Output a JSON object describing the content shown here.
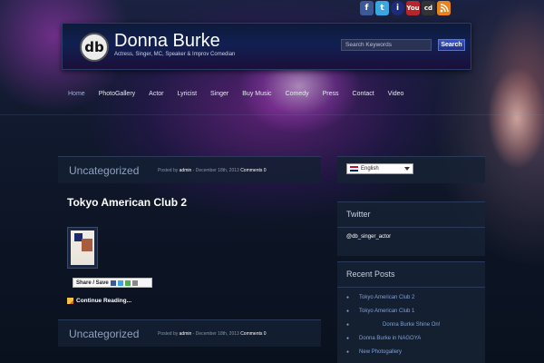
{
  "social": [
    "f",
    "t",
    "i",
    "You",
    "cd",
    "rss"
  ],
  "header": {
    "logo": "db",
    "title": "Donna Burke",
    "tagline": "Actress, Singer, MC, Speaker & Improv Comedian",
    "search_placeholder": "Search Keywords",
    "search_button": "Search"
  },
  "nav": [
    "Home",
    "PhotoGallery",
    "Actor",
    "Lyricist",
    "Singer",
    "Buy Music",
    "Comedy",
    "Press",
    "Contact",
    "Video"
  ],
  "posts": [
    {
      "category": "Uncategorized",
      "byline_prefix": "Posted by ",
      "author": "admin",
      "date": " - December 18th, 2013 ",
      "comments": "Comments 0",
      "title": "Tokyo American Club 2",
      "share_label": "Share / Save",
      "continue": "Continue Reading..."
    },
    {
      "category": "Uncategorized",
      "byline_prefix": "Posted by ",
      "author": "admin",
      "date": " - December 18th, 2013 ",
      "comments": "Comments 0"
    }
  ],
  "sidebar": {
    "language": "English",
    "twitter": {
      "title": "Twitter",
      "handle": "@db_singer_actor"
    },
    "recent": {
      "title": "Recent Posts",
      "items": [
        "Tokyo American Club 2",
        "Tokyo American Club 1",
        "Donna Burke Shine On!",
        "Donna Burke in NAGOYA",
        "New Photogallery"
      ]
    }
  }
}
